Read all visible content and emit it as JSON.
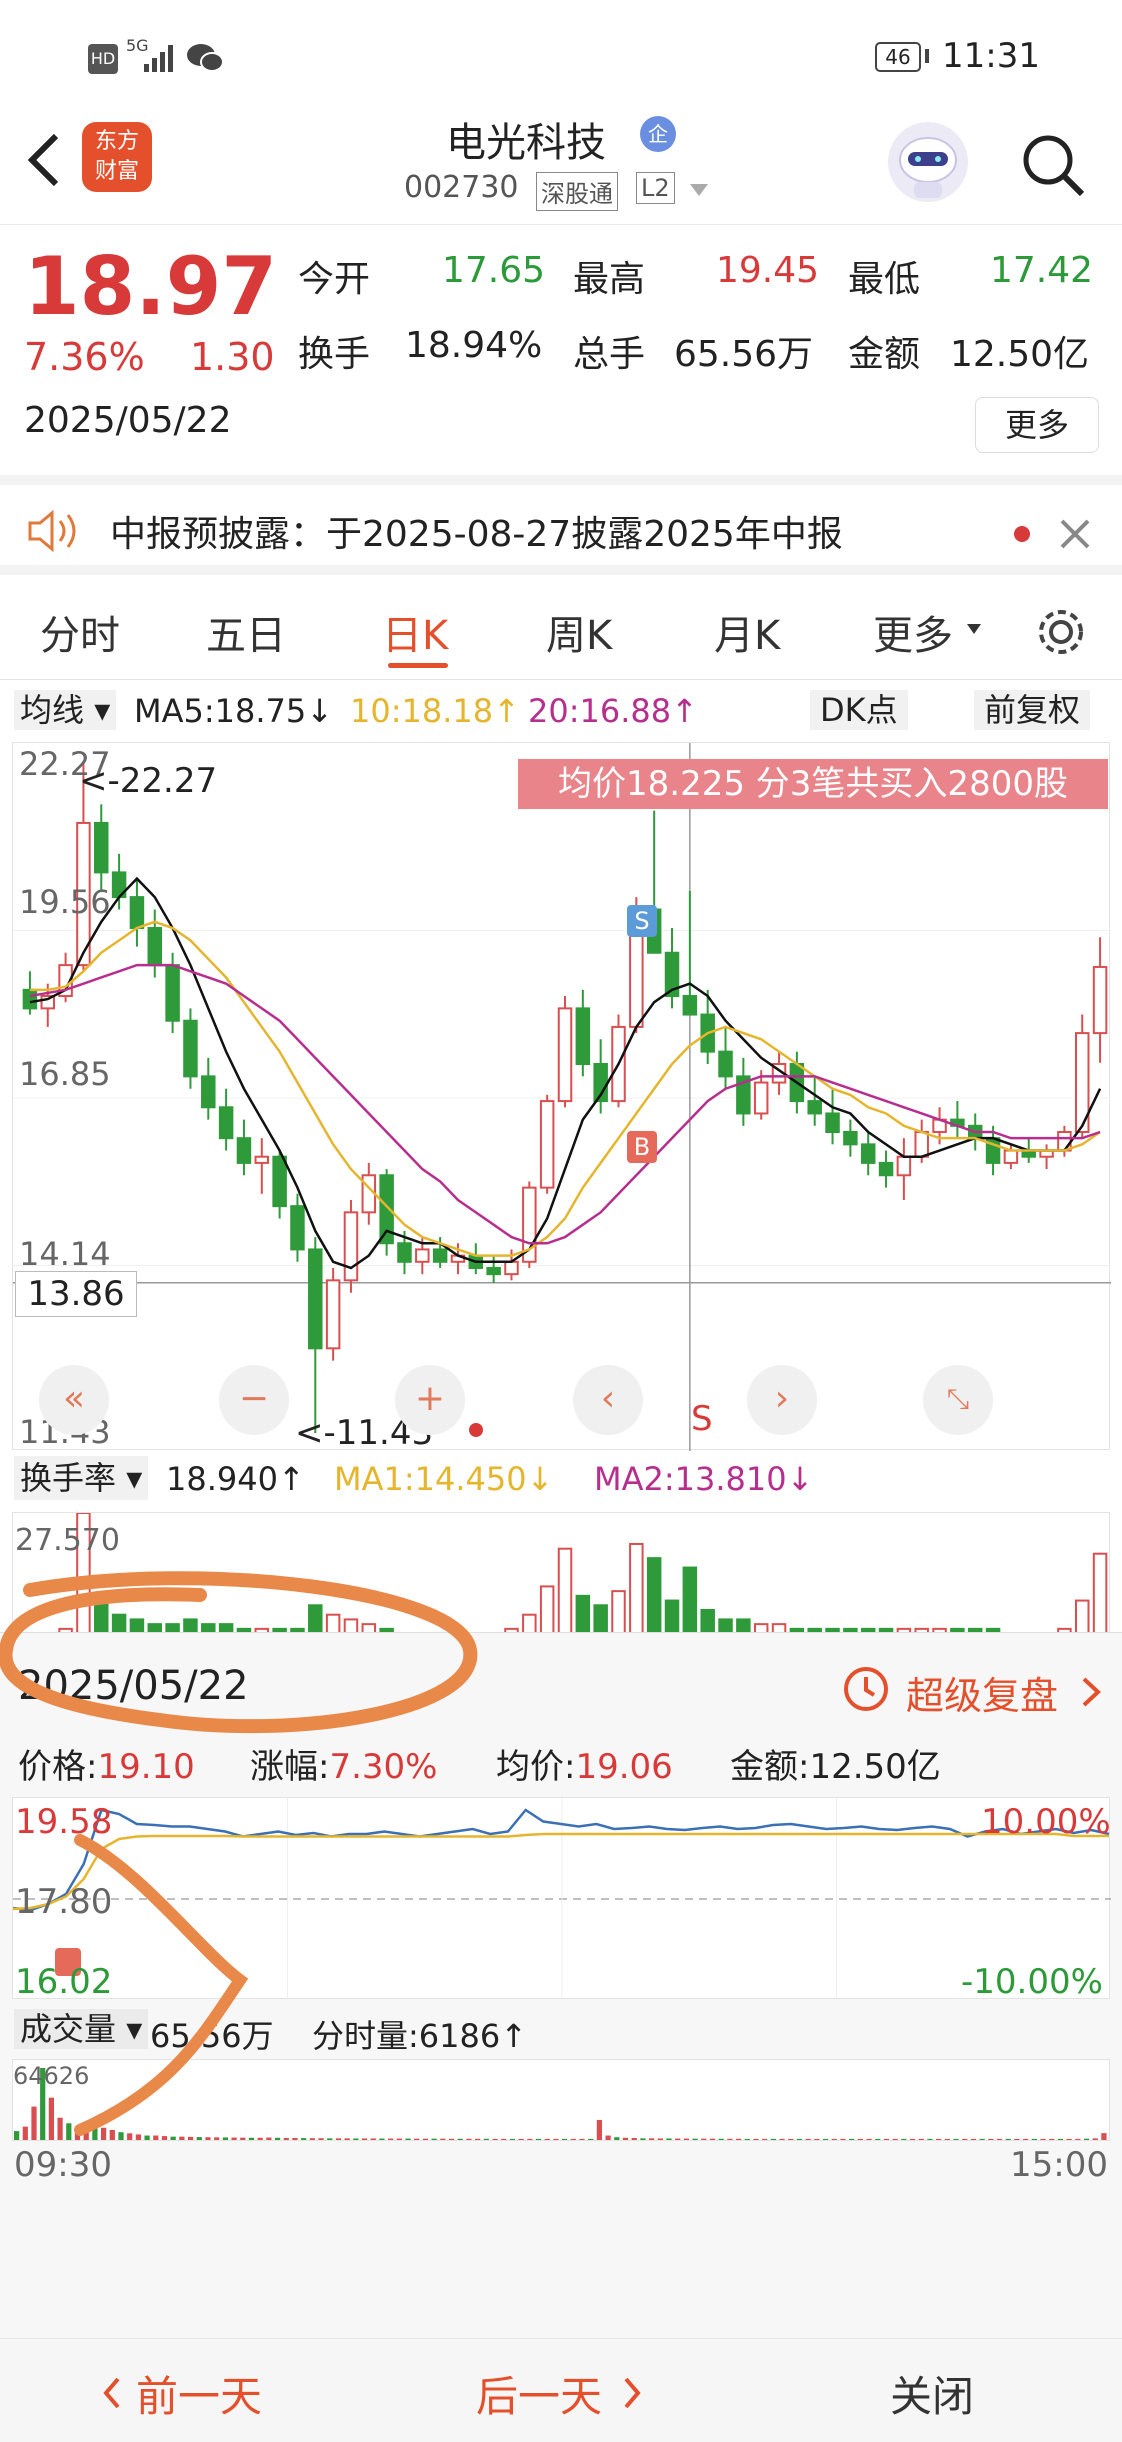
{
  "status": {
    "hd": "HD",
    "network": "5G",
    "battery": "46",
    "time": "11:31"
  },
  "header": {
    "logo_line1": "东方",
    "logo_line2": "财富",
    "stock_name": "电光科技",
    "badge": "企",
    "code": "002730",
    "connect": "深股通",
    "level": "L2"
  },
  "quote": {
    "price": "18.97",
    "change_pct": "7.36%",
    "change_amt": "1.30",
    "date": "2025/05/22",
    "open_label": "今开",
    "open": "17.65",
    "high_label": "最高",
    "high": "19.45",
    "low_label": "最低",
    "low": "17.42",
    "turnover_label": "换手",
    "turnover": "18.94%",
    "volume_label": "总手",
    "volume": "65.56万",
    "amount_label": "金额",
    "amount": "12.50亿",
    "more": "更多"
  },
  "announcement": {
    "text": "中报预披露：于2025-08-27披露2025年中报"
  },
  "tabs": [
    "分时",
    "五日",
    "日K",
    "周K",
    "月K",
    "更多"
  ],
  "ma_legend": {
    "selector": "均线",
    "ma5": "MA5:18.75↓",
    "ma10": "10:18.18↑",
    "ma20": "20:16.88↑",
    "dk": "DK点",
    "adjust": "前复权"
  },
  "kline": {
    "banner": "均价18.225  分3笔共买入2800股",
    "y_ticks": [
      "22.27",
      "19.56",
      "16.85",
      "14.14",
      "11.43"
    ],
    "max_label": "<-22.27",
    "min_label": "<-11.43",
    "cross_price": "13.86",
    "sell_marker": "S",
    "buy_marker": "B",
    "signal_s": "S",
    "ctrl_first": "«",
    "ctrl_minus": "−",
    "ctrl_plus": "+",
    "ctrl_prev": "‹",
    "ctrl_next": "›",
    "ctrl_expand": "⤡",
    "colors": {
      "up": "#d94f4f",
      "down": "#2f9a3a",
      "ma5": "#111111",
      "ma10": "#e5b52e",
      "ma20": "#b62f8e"
    }
  },
  "indicator": {
    "selector": "换手率",
    "value": "18.940↑",
    "ma1": "MA1:14.450↓",
    "ma2": "MA2:13.810↓",
    "axis_max": "27.570"
  },
  "replay": {
    "date": "2025/05/22",
    "super_link": "超级复盘",
    "price_label": "价格:",
    "price": "19.10",
    "change_label": "涨幅:",
    "change": "7.30%",
    "avg_label": "均价:",
    "avg": "19.06",
    "amount_label": "金额:",
    "amount": "12.50亿",
    "top_price": "19.58",
    "mid_price": "17.80",
    "bottom_price": "16.02",
    "top_pct": "10.00%",
    "bottom_pct": "-10.00%",
    "volume_selector": "成交量",
    "total_volume": "65.56万",
    "minute_volume": "分时量:6186↑",
    "vol_max": "64626",
    "time_start": "09:30",
    "time_end": "15:00"
  },
  "bottom": {
    "prev": "前一天",
    "next": "后一天",
    "close": "关闭"
  },
  "chart_data": [
    {
      "type": "candlestick",
      "title": "日K",
      "ylim": [
        11.43,
        22.27
      ],
      "y_ticks": [
        22.27,
        19.56,
        16.85,
        14.14,
        11.43
      ],
      "series": [
        {
          "name": "K",
          "ohlc": [
            [
              18.6,
              18.9,
              18.2,
              18.3
            ],
            [
              18.3,
              18.7,
              18.0,
              18.5
            ],
            [
              18.5,
              19.2,
              18.4,
              19.0
            ],
            [
              19.0,
              22.27,
              18.9,
              21.3
            ],
            [
              21.3,
              21.6,
              20.2,
              20.5
            ],
            [
              20.5,
              20.8,
              19.9,
              20.1
            ],
            [
              20.1,
              20.4,
              19.3,
              19.6
            ],
            [
              19.6,
              19.9,
              18.8,
              19.0
            ],
            [
              19.0,
              19.2,
              17.9,
              18.1
            ],
            [
              18.1,
              18.3,
              17.0,
              17.2
            ],
            [
              17.2,
              17.5,
              16.5,
              16.7
            ],
            [
              16.7,
              17.0,
              16.0,
              16.2
            ],
            [
              16.2,
              16.5,
              15.6,
              15.8
            ],
            [
              15.8,
              16.2,
              15.3,
              15.9
            ],
            [
              15.9,
              16.0,
              14.9,
              15.1
            ],
            [
              15.1,
              15.3,
              14.2,
              14.4
            ],
            [
              14.4,
              14.6,
              11.43,
              12.8
            ],
            [
              12.8,
              14.1,
              12.6,
              13.9
            ],
            [
              13.9,
              15.2,
              13.7,
              15.0
            ],
            [
              15.0,
              15.8,
              14.8,
              15.6
            ],
            [
              15.6,
              15.7,
              14.3,
              14.5
            ],
            [
              14.5,
              14.7,
              14.0,
              14.2
            ],
            [
              14.2,
              14.6,
              14.0,
              14.4
            ],
            [
              14.4,
              14.6,
              14.1,
              14.2
            ],
            [
              14.2,
              14.5,
              14.0,
              14.3
            ],
            [
              14.3,
              14.5,
              14.0,
              14.1
            ],
            [
              14.1,
              14.3,
              13.86,
              14.0
            ],
            [
              14.0,
              14.4,
              13.9,
              14.2
            ],
            [
              14.2,
              15.5,
              14.1,
              15.4
            ],
            [
              15.4,
              16.9,
              15.3,
              16.8
            ],
            [
              16.8,
              18.5,
              16.7,
              18.3
            ],
            [
              18.3,
              18.6,
              17.2,
              17.4
            ],
            [
              17.4,
              17.8,
              16.6,
              16.8
            ],
            [
              16.8,
              18.2,
              16.7,
              18.0
            ],
            [
              18.0,
              20.1,
              17.9,
              19.9
            ],
            [
              19.9,
              21.5,
              19.6,
              19.2
            ],
            [
              19.2,
              19.6,
              18.3,
              18.5
            ],
            [
              18.5,
              20.2,
              18.4,
              18.2
            ],
            [
              18.2,
              18.6,
              17.4,
              17.6
            ],
            [
              17.6,
              18.0,
              17.0,
              17.2
            ],
            [
              17.2,
              17.5,
              16.4,
              16.6
            ],
            [
              16.6,
              17.3,
              16.5,
              17.1
            ],
            [
              17.1,
              17.6,
              16.9,
              17.4
            ],
            [
              17.4,
              17.6,
              16.6,
              16.8
            ],
            [
              16.8,
              17.2,
              16.4,
              16.6
            ],
            [
              16.6,
              17.0,
              16.1,
              16.3
            ],
            [
              16.3,
              16.5,
              15.9,
              16.1
            ],
            [
              16.1,
              16.3,
              15.6,
              15.8
            ],
            [
              15.8,
              16.0,
              15.4,
              15.6
            ],
            [
              15.6,
              16.2,
              15.2,
              15.9
            ],
            [
              15.9,
              16.5,
              15.8,
              16.3
            ],
            [
              16.3,
              16.7,
              16.1,
              16.5
            ],
            [
              16.5,
              16.8,
              16.2,
              16.4
            ],
            [
              16.4,
              16.6,
              16.0,
              16.2
            ],
            [
              16.2,
              16.4,
              15.6,
              15.8
            ],
            [
              15.8,
              16.1,
              15.7,
              16.0
            ],
            [
              16.0,
              16.2,
              15.8,
              15.9
            ],
            [
              15.9,
              16.1,
              15.7,
              16.0
            ],
            [
              16.0,
              16.4,
              15.9,
              16.3
            ],
            [
              16.3,
              18.2,
              16.2,
              17.9
            ],
            [
              17.9,
              19.45,
              17.42,
              18.97
            ]
          ]
        },
        {
          "name": "MA5",
          "values": [
            18.4,
            18.45,
            18.6,
            19.2,
            19.7,
            20.1,
            20.4,
            20.1,
            19.6,
            19.0,
            18.3,
            17.6,
            17.0,
            16.5,
            16.0,
            15.4,
            14.7,
            14.2,
            14.1,
            14.3,
            14.7,
            14.6,
            14.5,
            14.5,
            14.3,
            14.2,
            14.2,
            14.2,
            14.4,
            14.9,
            15.7,
            16.5,
            16.9,
            17.4,
            18.0,
            18.4,
            18.6,
            18.7,
            18.5,
            18.1,
            17.8,
            17.5,
            17.3,
            17.1,
            16.9,
            16.7,
            16.6,
            16.3,
            16.1,
            15.9,
            15.9,
            16.0,
            16.1,
            16.2,
            16.2,
            16.1,
            16.0,
            16.0,
            16.0,
            16.4,
            17.0
          ]
        },
        {
          "name": "MA10",
          "values": [
            18.6,
            18.6,
            18.65,
            18.9,
            19.2,
            19.4,
            19.6,
            19.7,
            19.6,
            19.4,
            19.1,
            18.8,
            18.4,
            18.0,
            17.6,
            17.1,
            16.6,
            16.1,
            15.7,
            15.4,
            15.1,
            14.8,
            14.6,
            14.5,
            14.4,
            14.3,
            14.3,
            14.3,
            14.4,
            14.6,
            14.9,
            15.4,
            15.8,
            16.2,
            16.6,
            17.0,
            17.4,
            17.7,
            17.9,
            18.0,
            17.9,
            17.8,
            17.6,
            17.4,
            17.2,
            17.0,
            16.9,
            16.7,
            16.6,
            16.4,
            16.3,
            16.2,
            16.2,
            16.2,
            16.1,
            16.0,
            16.0,
            16.0,
            16.0,
            16.1,
            16.3
          ]
        },
        {
          "name": "MA20",
          "values": [
            18.5,
            18.55,
            18.6,
            18.7,
            18.8,
            18.9,
            19.0,
            19.0,
            19.0,
            18.9,
            18.8,
            18.7,
            18.5,
            18.3,
            18.1,
            17.8,
            17.5,
            17.2,
            16.9,
            16.6,
            16.3,
            16.0,
            15.7,
            15.5,
            15.2,
            15.0,
            14.8,
            14.6,
            14.5,
            14.5,
            14.6,
            14.8,
            15.0,
            15.3,
            15.6,
            15.9,
            16.2,
            16.5,
            16.8,
            17.0,
            17.1,
            17.2,
            17.2,
            17.2,
            17.2,
            17.1,
            17.0,
            16.9,
            16.8,
            16.7,
            16.6,
            16.5,
            16.4,
            16.3,
            16.3,
            16.2,
            16.2,
            16.2,
            16.2,
            16.2,
            16.3
          ]
        }
      ]
    },
    {
      "type": "bar",
      "title": "换手率",
      "ylim": [
        0,
        27.57
      ],
      "series": [
        {
          "name": "换手率",
          "values": [
            2,
            2,
            3,
            27.57,
            9,
            6,
            5,
            4,
            4,
            5,
            4,
            4,
            3,
            3,
            3,
            3,
            8,
            6,
            5,
            4,
            3,
            2,
            2,
            2,
            2,
            2,
            2,
            3,
            6,
            12,
            20,
            10,
            8,
            11,
            21,
            18,
            9,
            16,
            7,
            5,
            5,
            4,
            4,
            3,
            3,
            3,
            3,
            3,
            3,
            3,
            3,
            3,
            3,
            3,
            3,
            2,
            2,
            2,
            3,
            9,
            18.94
          ]
        }
      ]
    },
    {
      "type": "line",
      "title": "分时",
      "x": [
        "09:30",
        "15:00"
      ],
      "ylim": [
        16.02,
        19.58
      ],
      "series": [
        {
          "name": "价格",
          "values": [
            17.62,
            17.58,
            17.7,
            17.9,
            18.5,
            19.58,
            19.5,
            19.3,
            19.28,
            19.25,
            19.25,
            19.2,
            19.15,
            19.05,
            19.1,
            19.15,
            19.08,
            19.12,
            19.05,
            19.1,
            19.1,
            19.15,
            19.1,
            19.05,
            19.1,
            19.15,
            19.2,
            19.1,
            19.15,
            19.58,
            19.35,
            19.3,
            19.25,
            19.3,
            19.2,
            19.22,
            19.25,
            19.2,
            19.18,
            19.22,
            19.25,
            19.2,
            19.22,
            19.28,
            19.3,
            19.25,
            19.2,
            19.22,
            19.25,
            19.2,
            19.18,
            19.22,
            19.25,
            19.2,
            19.05,
            19.15,
            19.2,
            19.1,
            19.15,
            19.2,
            19.12,
            19.18,
            19.1
          ]
        },
        {
          "name": "均价",
          "values": [
            17.6,
            17.62,
            17.7,
            17.85,
            18.2,
            18.8,
            19.0,
            19.05,
            19.06,
            19.06,
            19.06,
            19.06,
            19.06,
            19.05,
            19.05,
            19.05,
            19.05,
            19.05,
            19.05,
            19.05,
            19.05,
            19.05,
            19.05,
            19.05,
            19.05,
            19.05,
            19.05,
            19.05,
            19.05,
            19.08,
            19.1,
            19.1,
            19.1,
            19.1,
            19.1,
            19.1,
            19.1,
            19.1,
            19.1,
            19.1,
            19.1,
            19.1,
            19.1,
            19.1,
            19.1,
            19.1,
            19.1,
            19.1,
            19.1,
            19.1,
            19.1,
            19.1,
            19.1,
            19.1,
            19.1,
            19.1,
            19.1,
            19.1,
            19.1,
            19.1,
            19.06,
            19.06,
            19.06
          ]
        }
      ]
    },
    {
      "type": "bar",
      "title": "成交量",
      "ylim": [
        0,
        64626
      ],
      "series": [
        {
          "name": "分时量",
          "values": [
            8000,
            12000,
            30000,
            64626,
            38000,
            20000,
            15000,
            12000,
            9000,
            14000,
            11000,
            9000,
            7000,
            6000,
            5000,
            4000,
            4000,
            3500,
            3000,
            3000,
            2800,
            2600,
            2500,
            2400,
            2300,
            2200,
            2100,
            2000,
            2000,
            2200,
            2000,
            1800,
            1800,
            1700,
            1600,
            1600,
            1500,
            1500,
            1500,
            1400,
            1400,
            1400,
            1300,
            1300,
            1300,
            1300,
            1200,
            1200,
            1200,
            1200,
            1100,
            1100,
            1100,
            1100,
            1100,
            1000,
            1000,
            1000,
            1000,
            1000,
            1000,
            1000,
            1000,
            1000,
            1000,
            1000,
            1000,
            18000,
            4000,
            2500,
            2000,
            1800,
            1500,
            1500,
            1400,
            1400,
            1300,
            1300,
            1200,
            1200,
            1200,
            1100,
            1100,
            1100,
            1000,
            1000,
            1000,
            1000,
            1000,
            1000,
            1000,
            1000,
            1000,
            1000,
            1000,
            1000,
            1000,
            1000,
            1000,
            1000,
            1000,
            1000,
            1000,
            1000,
            1000,
            1000,
            1000,
            1000,
            1000,
            1000,
            1000,
            1000,
            1000,
            1000,
            1000,
            1000,
            1000,
            1000,
            1000,
            1000,
            1000,
            1000,
            1000,
            1200,
            1500,
            6186
          ]
        }
      ]
    }
  ]
}
